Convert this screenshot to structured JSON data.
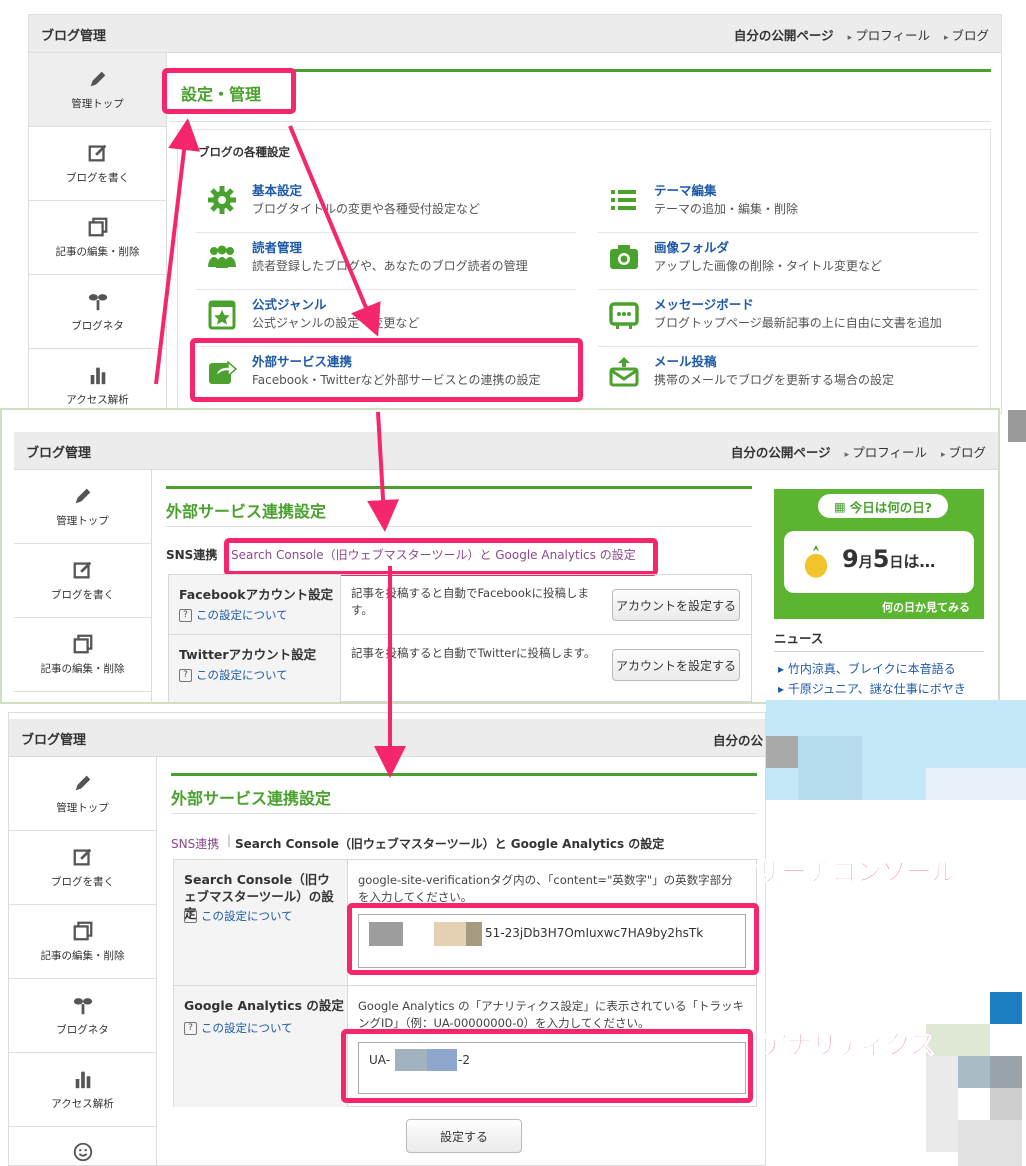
{
  "header": {
    "title": "ブログ管理",
    "public_page": "自分の公開ページ",
    "profile": "プロフィール",
    "blog": "ブログ",
    "public_page_cut": "自分の公"
  },
  "sidebar": {
    "items": [
      {
        "label": "管理トップ",
        "icon": "pencil-icon"
      },
      {
        "label": "ブログを書く",
        "icon": "edit-icon"
      },
      {
        "label": "記事の編集・削除",
        "icon": "files-icon"
      },
      {
        "label": "ブログネタ",
        "icon": "sprout-icon"
      },
      {
        "label": "アクセス解析",
        "icon": "bar-chart-icon"
      }
    ]
  },
  "panel1": {
    "section_title": "設定・管理",
    "group_heading": "ブログの各種設定",
    "items": [
      {
        "title": "基本設定",
        "desc": "ブログタイトルの変更や各種受付設定など",
        "icon": "gear-icon"
      },
      {
        "title": "テーマ編集",
        "desc": "テーマの追加・編集・削除",
        "icon": "list-icon"
      },
      {
        "title": "読者管理",
        "desc": "読者登録したブログや、あなたのブログ読者の管理",
        "icon": "users-icon"
      },
      {
        "title": "画像フォルダ",
        "desc": "アップした画像の削除・タイトル変更など",
        "icon": "camera-icon"
      },
      {
        "title": "公式ジャンル",
        "desc": "公式ジャンルの設定・変更など",
        "icon": "star-frame-icon"
      },
      {
        "title": "メッセージボード",
        "desc": "ブログトップページ最新記事の上に自由に文書を追加",
        "icon": "board-icon"
      },
      {
        "title": "外部サービス連携",
        "desc": "Facebook・Twitterなど外部サービスとの連携の設定",
        "icon": "share-icon"
      },
      {
        "title": "メール投稿",
        "desc": "携帯のメールでブログを更新する場合の設定",
        "icon": "mail-icon"
      }
    ]
  },
  "panel2": {
    "section_title": "外部サービス連携設定",
    "tab_sns": "SNS連携",
    "tab_link": "Search Console（旧ウェブマスターツール）と Google Analytics の設定",
    "rows": [
      {
        "label": "Facebookアカウント設定",
        "help": "この設定について",
        "desc": "記事を投稿すると自動でFacebookに投稿します。",
        "button": "アカウントを設定する"
      },
      {
        "label": "Twitterアカウント設定",
        "help": "この設定について",
        "desc": "記事を投稿すると自動でTwitterに投稿します。",
        "button": "アカウントを設定する"
      }
    ],
    "widget": {
      "badge": "今日は何の日?",
      "date_month": "9",
      "date_day": "5",
      "month_unit": "月",
      "day_unit": "日",
      "suffix": "は…",
      "link": "何の日か見てみる"
    },
    "news_title": "ニュース",
    "news": [
      "竹内涼真、ブレイクに本音語る",
      "千原ジュニア、謎な仕事にボヤき"
    ]
  },
  "panel3": {
    "section_title": "外部サービス連携設定",
    "tab_sns": "SNS連携",
    "tab_current": "Search Console（旧ウェブマスターツール）と Google Analytics の設定",
    "rows": [
      {
        "label": "Search Console（旧ウェブマスターツール）の設定",
        "help": "この設定について",
        "desc": "google-site-verificationタグ内の、「content=\"英数字\"」の英数字部分を入力してください。",
        "value": "51-23jDb3H7OmIuxwc7HA9by2hsTk"
      },
      {
        "label": "Google Analytics の設定",
        "help": "この設定について",
        "desc": "Google Analytics の「アナリティクス設定」に表示されている「トラッキングID」（例：UA-00000000-0）を入力してください。",
        "value_prefix": "UA-",
        "value_suffix": "-2"
      }
    ],
    "submit": "設定する",
    "callout_sc": "サーチコンソール",
    "callout_ga": "アナリティクス"
  },
  "colors": {
    "accent": "#4aa12d",
    "highlight": "#f5256e",
    "link": "#1f5aa8"
  }
}
